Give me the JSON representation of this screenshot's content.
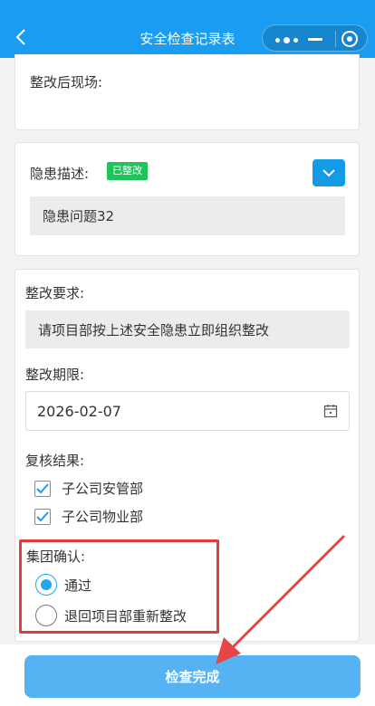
{
  "header": {
    "title": "安全检查记录表"
  },
  "rectified_scene": {
    "label": "整改后现场:"
  },
  "hazard": {
    "label": "隐患描述:",
    "status_badge": "已整改",
    "value": "隐患问题32"
  },
  "rectification": {
    "requirement_label": "整改要求:",
    "requirement_value": "请项目部按上述安全隐患立即组织整改",
    "deadline_label": "整改期限:",
    "deadline_value": "2026-02-07"
  },
  "review": {
    "label": "复核结果:",
    "options": [
      {
        "label": "子公司安管部",
        "checked": true
      },
      {
        "label": "子公司物业部",
        "checked": true
      }
    ]
  },
  "group_confirm": {
    "label": "集团确认:",
    "options": [
      {
        "label": "通过",
        "selected": true
      },
      {
        "label": "退回项目部重新整改",
        "selected": false
      }
    ]
  },
  "footer": {
    "submit_label": "检查完成"
  },
  "colors": {
    "header_bg": "#1a9cf0",
    "accent": "#23a6f0",
    "badge_green": "#1ec45a",
    "highlight_red": "#e23c3c",
    "submit_bg": "#55b3f3"
  }
}
